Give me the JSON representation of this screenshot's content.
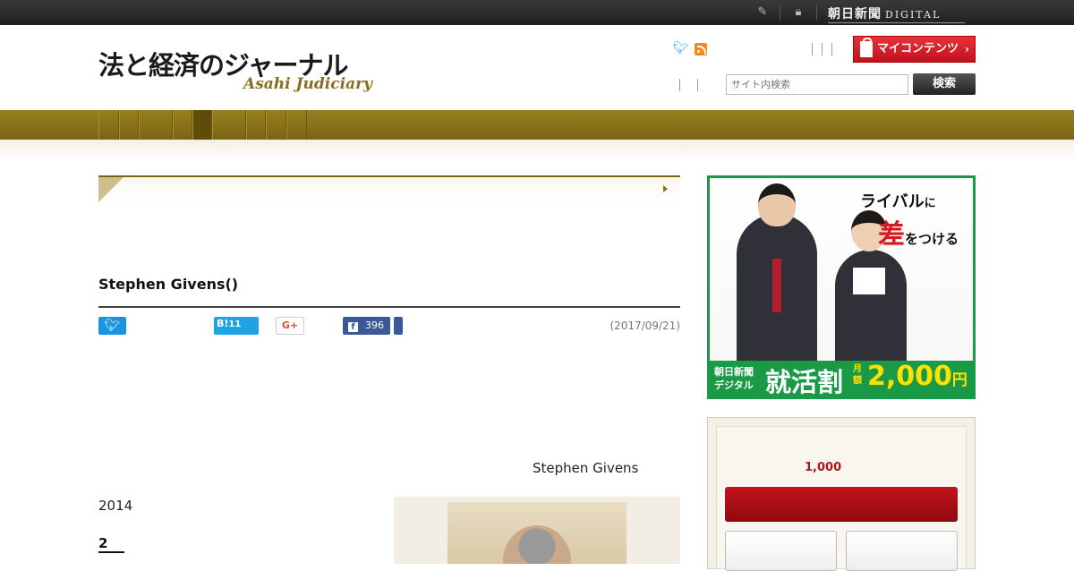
{
  "topbar": {
    "brand_name": "朝日新聞",
    "brand_suffix": "DIGITAL",
    "icons": [
      "edit-icon",
      "lock-icon"
    ]
  },
  "header": {
    "logo_title": "法と経済のジャーナル",
    "logo_subtitle": "Asahi Judiciary",
    "social_icons": [
      "twitter-icon",
      "rss-icon"
    ],
    "my_content_label": "マイコンテンツ",
    "search": {
      "placeholder": "サイト内検索",
      "button_label": "検索"
    }
  },
  "nav": {
    "tabs": [
      "",
      "",
      "",
      "",
      "",
      "",
      "",
      "",
      ""
    ],
    "active_index": 4
  },
  "article": {
    "title": "Stephen Givens()",
    "share": {
      "hatena_label": "B!",
      "hatena_count": "11",
      "gplus_label": "G+",
      "facebook_count": "396"
    },
    "date": "(2017/09/21)",
    "author_line": "Stephen Givens",
    "year": "2014",
    "chapter": "2"
  },
  "sidebar": {
    "ad": {
      "line1_main": "ライバル",
      "line1_small": "に",
      "line2_main": "差",
      "line2_small": "をつける",
      "band_brand_1": "朝日新聞",
      "band_brand_2": "デジタル",
      "band_offer": "就活割",
      "band_month": "月額",
      "band_price": "2,000",
      "band_yen": "円",
      "colors": {
        "green": "#1a9a46",
        "red": "#d71920",
        "yellow": "#ffe100"
      }
    },
    "promo": {
      "price": "1,000"
    }
  },
  "colors": {
    "gold": "#7a6415",
    "accent_red": "#c3121c"
  }
}
